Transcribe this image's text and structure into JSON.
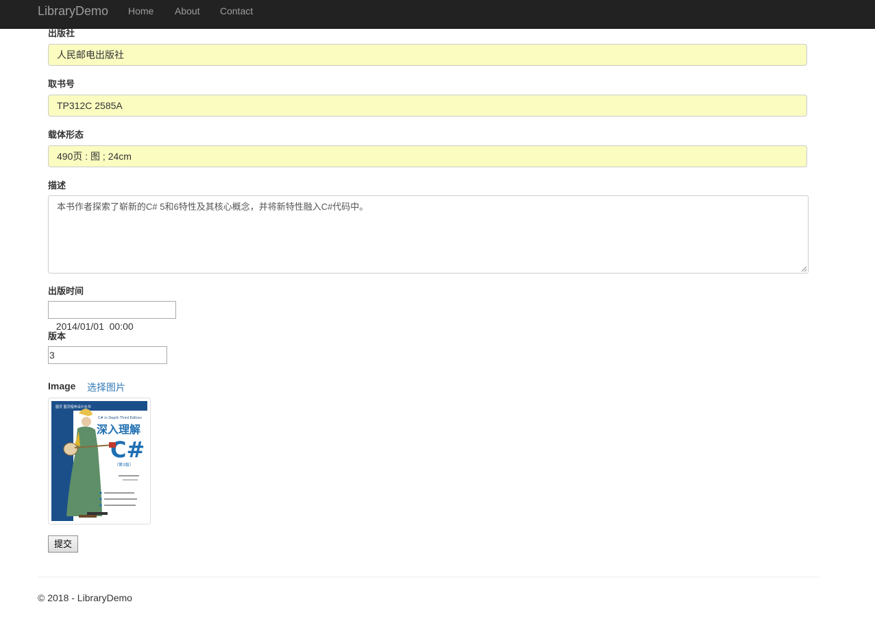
{
  "navbar": {
    "brand": "LibraryDemo",
    "links": [
      "Home",
      "About",
      "Contact"
    ]
  },
  "form": {
    "publisher": {
      "label": "出版社",
      "value": "人民邮电出版社"
    },
    "call_number": {
      "label": "取书号",
      "value": "TP312C 2585A"
    },
    "format": {
      "label": "载体形态",
      "value": "490页 : 图 ; 24cm"
    },
    "description": {
      "label": "描述",
      "value": "本书作者探索了崭新的C# 5和6特性及其核心概念，并将新特性融入C#代码中。"
    },
    "publish_date": {
      "label": "出版时间",
      "value": "2014/01/01  00:00"
    },
    "edition": {
      "label": "版本",
      "value": "3"
    },
    "image": {
      "label": "Image",
      "choose_link": "选择图片"
    },
    "submit_label": "提交"
  },
  "cover": {
    "series_text": "图灵  图灵程序设计丛书",
    "subtitle_en": "C# in Depth  Third Edition",
    "title_cn": "深入理解",
    "title_big": "C#",
    "edition_cn": "（第3版）",
    "colors": {
      "spine": "#1b4f8a",
      "title": "#1f6fb2",
      "dress": "#5e8f68"
    }
  },
  "footer": {
    "text": "© 2018 - LibraryDemo"
  }
}
